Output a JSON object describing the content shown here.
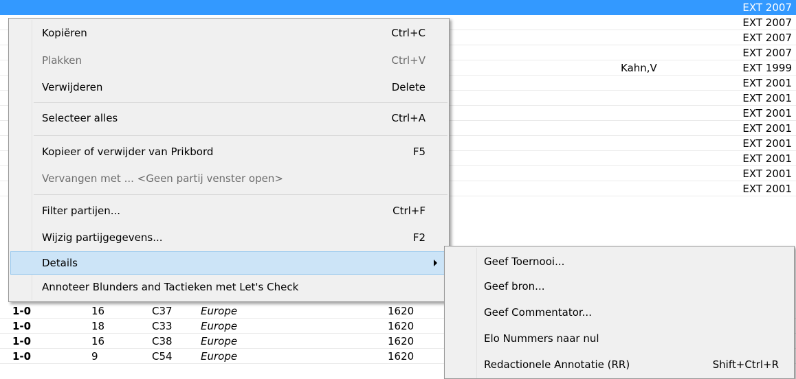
{
  "table": {
    "selected_row": {
      "tag": "EXT 2007"
    },
    "right_rows": [
      {
        "annotator": "",
        "tag": "EXT 2007"
      },
      {
        "annotator": "",
        "tag": "EXT 2007"
      },
      {
        "annotator": "",
        "tag": "EXT 2007"
      },
      {
        "annotator": "Kahn,V",
        "tag": "EXT 1999"
      },
      {
        "annotator": "",
        "tag": "EXT 2001"
      },
      {
        "annotator": "",
        "tag": "EXT 2001"
      },
      {
        "annotator": "",
        "tag": "EXT 2001"
      },
      {
        "annotator": "",
        "tag": "EXT 2001"
      },
      {
        "annotator": "",
        "tag": "EXT 2001"
      },
      {
        "annotator": "",
        "tag": "EXT 2001"
      },
      {
        "annotator": "",
        "tag": "EXT 2001"
      },
      {
        "annotator": "",
        "tag": "EXT 2001"
      }
    ],
    "bottom_rows": [
      {
        "result": "1-0",
        "moves": "16",
        "eco": "C37",
        "source": "Europe",
        "elo": "1620"
      },
      {
        "result": "1-0",
        "moves": "18",
        "eco": "C33",
        "source": "Europe",
        "elo": "1620"
      },
      {
        "result": "1-0",
        "moves": "16",
        "eco": "C38",
        "source": "Europe",
        "elo": "1620"
      },
      {
        "result": "1-0",
        "moves": "9",
        "eco": "C54",
        "source": "Europe",
        "elo": "1620"
      }
    ]
  },
  "context_menu": {
    "items": [
      {
        "label": "Kopiëren",
        "shortcut": "Ctrl+C"
      },
      {
        "label": "Plakken",
        "shortcut": "Ctrl+V"
      },
      {
        "label": "Verwijderen",
        "shortcut": "Delete"
      },
      {
        "label": "Selecteer alles",
        "shortcut": "Ctrl+A"
      },
      {
        "label": "Kopieer of verwijder van Prikbord",
        "shortcut": "F5"
      },
      {
        "label": "Vervangen met ... <Geen partij venster open>",
        "shortcut": ""
      },
      {
        "label": "Filter partijen...",
        "shortcut": "Ctrl+F"
      },
      {
        "label": "Wijzig partijgegevens...",
        "shortcut": "F2"
      },
      {
        "label": "Details",
        "shortcut": ""
      },
      {
        "label": "Annoteer Blunders and Tactieken met Let's Check",
        "shortcut": ""
      }
    ]
  },
  "submenu": {
    "items": [
      {
        "label": "Geef Toernooi...",
        "shortcut": ""
      },
      {
        "label": "Geef bron...",
        "shortcut": ""
      },
      {
        "label": "Geef Commentator...",
        "shortcut": ""
      },
      {
        "label": "Elo Nummers naar nul",
        "shortcut": ""
      },
      {
        "label": "Redactionele Annotatie (RR)",
        "shortcut": "Shift+Ctrl+R"
      }
    ]
  },
  "colors": {
    "selection": "#3399ff",
    "menu_bg": "#f0f0f0",
    "hover": "#cce4f7"
  }
}
